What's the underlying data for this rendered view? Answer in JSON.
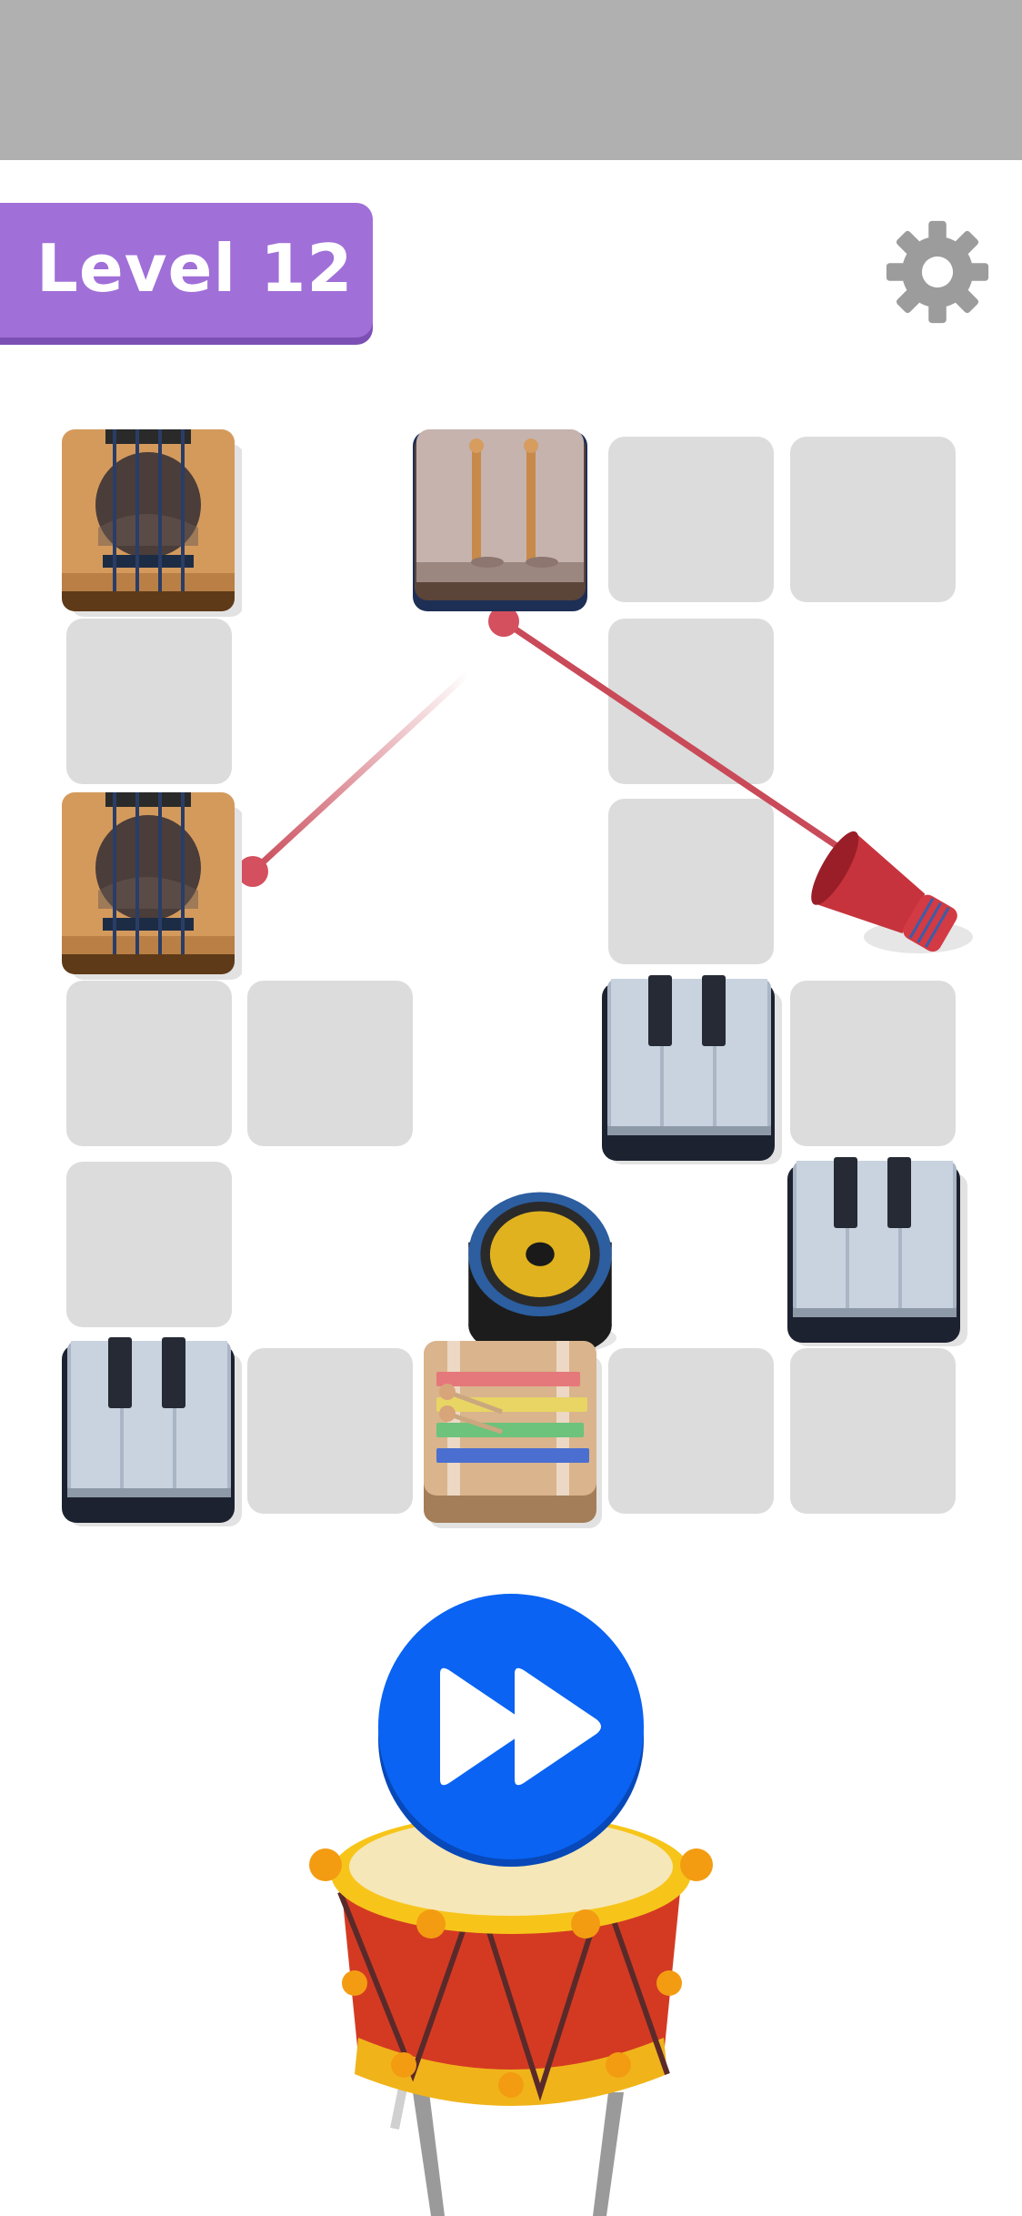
{
  "header": {
    "level_label": "Level 12"
  },
  "icons": {
    "settings": "gear-icon",
    "play": "fast-forward-icon",
    "pedestal": "drum-icon"
  },
  "colors": {
    "top_bar": "#b0b0b0",
    "level_badge": "#a06fd8",
    "tile": "#dcdcdc",
    "laser": "#c94a58",
    "play_button": "#0a63f2",
    "drum_body": "#d43a22",
    "drum_rim": "#f7c51a"
  },
  "board": {
    "columns": 5,
    "rows": 6,
    "pieces": [
      {
        "type": "guitar",
        "col": 1,
        "row": 1
      },
      {
        "type": "drumsticks",
        "col": 3,
        "row": 1
      },
      {
        "type": "guitar",
        "col": 1,
        "row": 3
      },
      {
        "type": "megaphone",
        "col": 5,
        "row": 3
      },
      {
        "type": "piano",
        "col": 4,
        "row": 4
      },
      {
        "type": "piano",
        "col": 5,
        "row": 5
      },
      {
        "type": "speaker",
        "col": 3,
        "row": 5
      },
      {
        "type": "piano",
        "col": 1,
        "row": 6
      },
      {
        "type": "xylophone",
        "col": 3,
        "row": 6
      }
    ]
  }
}
